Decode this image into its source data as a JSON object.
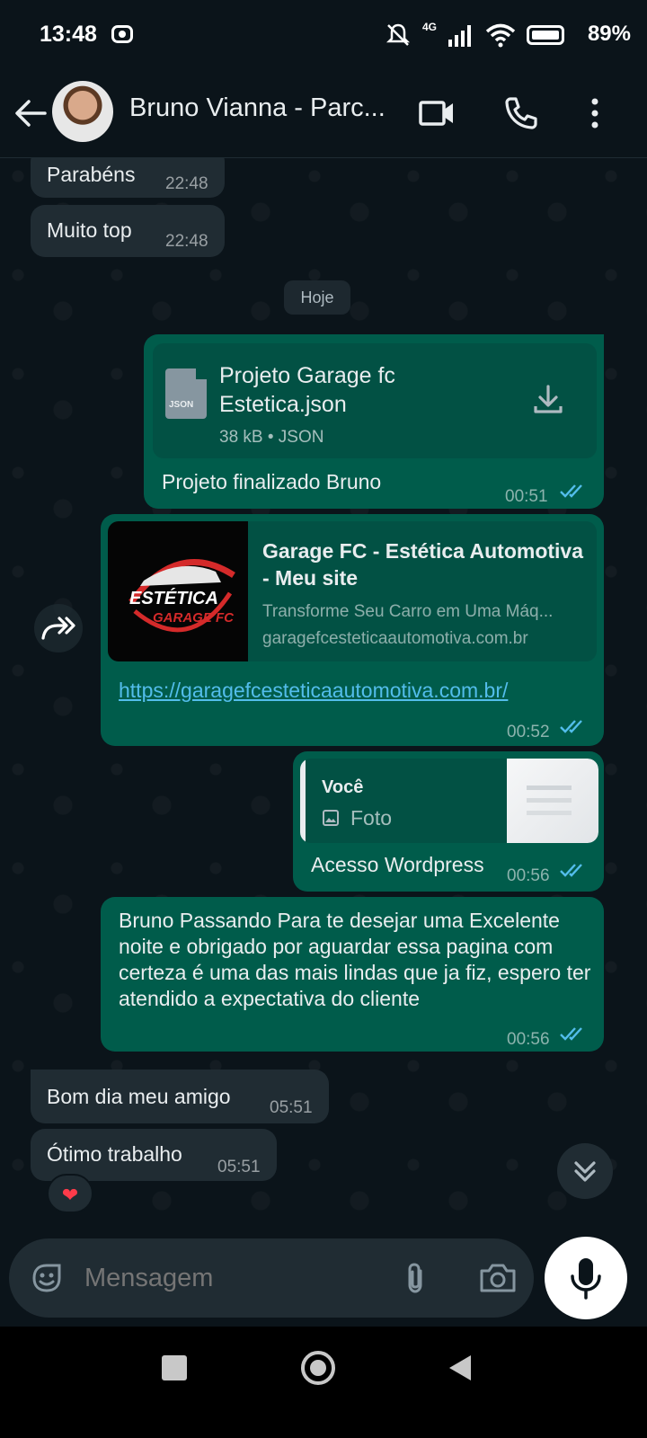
{
  "status_bar": {
    "time": "13:48",
    "network": "4G",
    "battery": "89%"
  },
  "header": {
    "contact_name": "Bruno Vianna - Parc..."
  },
  "messages": [
    {
      "direction": "in",
      "text": "Parabéns",
      "time": "22:48"
    },
    {
      "direction": "in",
      "text": "Muito top",
      "time": "22:48"
    },
    {
      "type": "date",
      "text": "Hoje"
    },
    {
      "direction": "out",
      "type": "document",
      "file_name": "Projeto Garage fc Estetica.json",
      "file_icon_label": "JSON",
      "file_meta": "38 kB • JSON",
      "caption": "Projeto finalizado Bruno",
      "time": "00:51",
      "status": "read"
    },
    {
      "direction": "out",
      "type": "link",
      "preview_title": "Garage FC - Estética Automotiva - Meu site",
      "preview_description": "Transforme Seu Carro em Uma Máq...",
      "preview_domain": "garagefcesteticaautomotiva.com.br",
      "thumbnail_text_1": "ESTÉTICA",
      "thumbnail_text_2": "GARAGE FC",
      "url": "https://garagefcesteticaautomotiva.com.br/",
      "time": "00:52",
      "status": "read"
    },
    {
      "direction": "out",
      "type": "reply",
      "quote_author": "Você",
      "quote_type": "Foto",
      "text": "Acesso Wordpress",
      "time": "00:56",
      "status": "read"
    },
    {
      "direction": "out",
      "text": "Bruno Passando Para te desejar uma Excelente noite e obrigado por aguardar essa pagina com certeza é uma das mais lindas que ja fiz, espero ter atendido a expectativa do cliente",
      "time": "00:56",
      "status": "read"
    },
    {
      "direction": "in",
      "text": "Bom dia meu amigo",
      "time": "05:51"
    },
    {
      "direction": "in",
      "text": "Ótimo trabalho",
      "time": "05:51",
      "reaction": "❤"
    }
  ],
  "composer": {
    "placeholder": "Mensagem"
  },
  "colors": {
    "incoming_bubble": "#202c33",
    "outgoing_bubble": "#005c4b",
    "read_ticks": "#53bdeb",
    "background": "#0b141a"
  },
  "icons": [
    "back-arrow-icon",
    "video-call-icon",
    "phone-icon",
    "more-options-icon",
    "download-icon",
    "forward-icon",
    "photo-icon",
    "scroll-down-icon",
    "sticker-icon",
    "attach-icon",
    "camera-icon",
    "mic-icon",
    "nav-recents-icon",
    "nav-home-icon",
    "nav-back-icon"
  ]
}
